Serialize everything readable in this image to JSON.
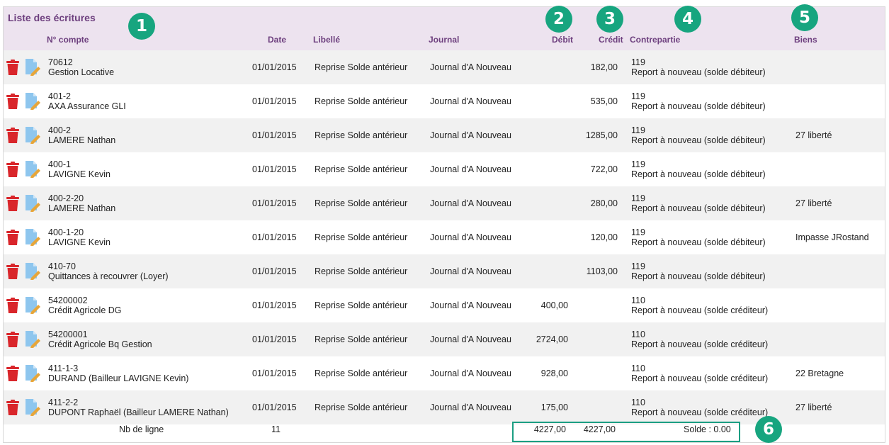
{
  "title": "Liste des écritures",
  "columns": {
    "compte": "N° compte",
    "date": "Date",
    "libelle": "Libellé",
    "journal": "Journal",
    "debit": "Débit",
    "credit": "Crédit",
    "contrepartie": "Contrepartie",
    "biens": "Biens"
  },
  "rows": [
    {
      "num": "70612",
      "name": "Gestion Locative",
      "date": "01/01/2015",
      "libelle": "Reprise Solde antérieur",
      "journal": "Journal d'A Nouveau",
      "debit": "",
      "credit": "182,00",
      "contre_num": "119",
      "contre_label": "Report à nouveau (solde débiteur)",
      "biens": ""
    },
    {
      "num": "401-2",
      "name": "AXA Assurance GLI",
      "date": "01/01/2015",
      "libelle": "Reprise Solde antérieur",
      "journal": "Journal d'A Nouveau",
      "debit": "",
      "credit": "535,00",
      "contre_num": "119",
      "contre_label": "Report à nouveau (solde débiteur)",
      "biens": ""
    },
    {
      "num": "400-2",
      "name": "LAMERE Nathan",
      "date": "01/01/2015",
      "libelle": "Reprise Solde antérieur",
      "journal": "Journal d'A Nouveau",
      "debit": "",
      "credit": "1285,00",
      "contre_num": "119",
      "contre_label": "Report à nouveau (solde débiteur)",
      "biens": "27 liberté"
    },
    {
      "num": "400-1",
      "name": "LAVIGNE Kevin",
      "date": "01/01/2015",
      "libelle": "Reprise Solde antérieur",
      "journal": "Journal d'A Nouveau",
      "debit": "",
      "credit": "722,00",
      "contre_num": "119",
      "contre_label": "Report à nouveau (solde débiteur)",
      "biens": ""
    },
    {
      "num": "400-2-20",
      "name": "LAMERE Nathan",
      "date": "01/01/2015",
      "libelle": "Reprise Solde antérieur",
      "journal": "Journal d'A Nouveau",
      "debit": "",
      "credit": "280,00",
      "contre_num": "119",
      "contre_label": "Report à nouveau (solde débiteur)",
      "biens": "27 liberté"
    },
    {
      "num": "400-1-20",
      "name": "LAVIGNE Kevin",
      "date": "01/01/2015",
      "libelle": "Reprise Solde antérieur",
      "journal": "Journal d'A Nouveau",
      "debit": "",
      "credit": "120,00",
      "contre_num": "119",
      "contre_label": "Report à nouveau (solde débiteur)",
      "biens": "Impasse JRostand"
    },
    {
      "num": "410-70",
      "name": "Quittances à recouvrer (Loyer)",
      "date": "01/01/2015",
      "libelle": "Reprise Solde antérieur",
      "journal": "Journal d'A Nouveau",
      "debit": "",
      "credit": "1103,00",
      "contre_num": "119",
      "contre_label": "Report à nouveau (solde débiteur)",
      "biens": ""
    },
    {
      "num": "54200002",
      "name": "Crédit Agricole DG",
      "date": "01/01/2015",
      "libelle": "Reprise Solde antérieur",
      "journal": "Journal d'A Nouveau",
      "debit": "400,00",
      "credit": "",
      "contre_num": "110",
      "contre_label": "Report à nouveau (solde créditeur)",
      "biens": ""
    },
    {
      "num": "54200001",
      "name": "Crédit Agricole Bq Gestion",
      "date": "01/01/2015",
      "libelle": "Reprise Solde antérieur",
      "journal": "Journal d'A Nouveau",
      "debit": "2724,00",
      "credit": "",
      "contre_num": "110",
      "contre_label": "Report à nouveau (solde créditeur)",
      "biens": ""
    },
    {
      "num": "411-1-3",
      "name": "DURAND (Bailleur LAVIGNE Kevin)",
      "date": "01/01/2015",
      "libelle": "Reprise Solde antérieur",
      "journal": "Journal d'A Nouveau",
      "debit": "928,00",
      "credit": "",
      "contre_num": "110",
      "contre_label": "Report à nouveau (solde créditeur)",
      "biens": "22 Bretagne"
    },
    {
      "num": "411-2-2",
      "name": "DUPONT Raphaël (Bailleur LAMERE Nathan)",
      "date": "01/01/2015",
      "libelle": "Reprise Solde antérieur",
      "journal": "Journal d'A Nouveau",
      "debit": "175,00",
      "credit": "",
      "contre_num": "110",
      "contre_label": "Report à nouveau (solde créditeur)",
      "biens": "27 liberté"
    }
  ],
  "footer": {
    "nb_label": "Nb de ligne",
    "nb_value": "11",
    "total_debit": "4227,00",
    "total_credit": "4227,00",
    "solde": "Solde : 0.00"
  },
  "badges": [
    "1",
    "2",
    "3",
    "4",
    "5",
    "6"
  ],
  "colors": {
    "header_bg": "#ede3ef",
    "header_text": "#6d3f7e",
    "row_alt": "#f1f1f1",
    "badge": "#17a57f",
    "highlight_border": "#1a9e82",
    "trash": "#d9262b",
    "edit_doc": "#8ec6ee",
    "edit_pencil": "#e7a63a"
  },
  "icons": {
    "delete": "trash-icon",
    "edit": "edit-document-icon"
  }
}
